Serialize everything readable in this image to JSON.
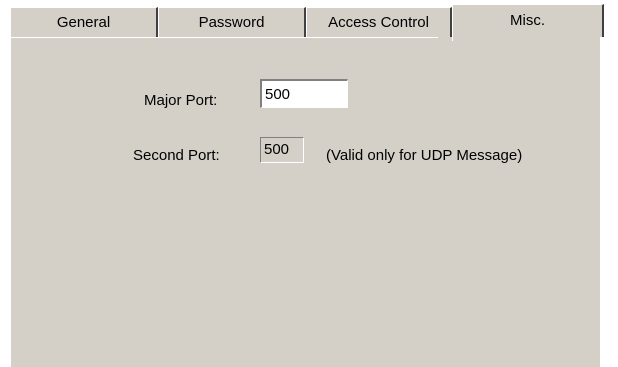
{
  "tabs": [
    {
      "label": "General",
      "selected": false
    },
    {
      "label": "Password",
      "selected": false
    },
    {
      "label": "Access Control",
      "selected": false
    },
    {
      "label": "Misc.",
      "selected": true
    }
  ],
  "misc": {
    "major_port_label": "Major Port:",
    "major_port_value": "500",
    "second_port_label": "Second Port:",
    "second_port_value": "500",
    "second_port_note": "(Valid only for UDP Message)"
  },
  "colors": {
    "dialog_face": "#d4d0c8",
    "field_background": "#ffffff",
    "shadow": "#808080",
    "dark_shadow": "#404040",
    "highlight": "#ffffff"
  }
}
